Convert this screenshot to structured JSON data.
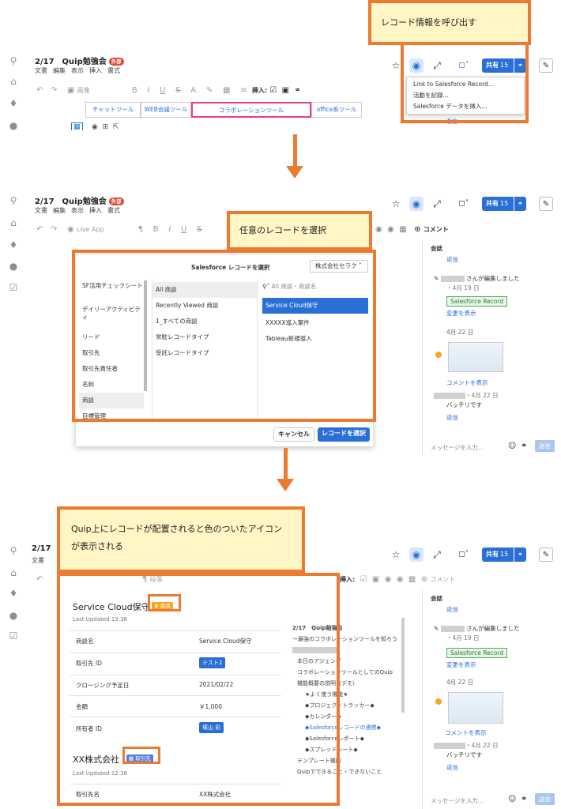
{
  "callouts": {
    "top": "レコード情報を呼び出す",
    "middle": "任意のレコードを選択",
    "bottom": "Quip上にレコードが配置されると色のついたアイコンが表示される"
  },
  "doc": {
    "title": "2/17　Quip勉強会",
    "badge": "外部",
    "menu": [
      "文書",
      "編集",
      "表示",
      "挿入",
      "書式"
    ]
  },
  "header": {
    "share_label": "共有",
    "share_count": "15"
  },
  "toolbar1": {
    "image_label": "画像",
    "insert_label": "挿入:"
  },
  "dropdown": {
    "items": [
      "Link to Salesforce Record...",
      "活動を記録...",
      "Salesforce データを挿入..."
    ]
  },
  "table1": {
    "cells": [
      "チャットツール",
      "WEB会議ツール",
      "コラボレーションツール",
      "office系ツール"
    ]
  },
  "toolbar2": {
    "live_app": "Live App",
    "comment": "コメント"
  },
  "conversation": {
    "header": "会話",
    "reply": "返信",
    "edit_text": "さんが編集しました",
    "date1": "・4月 19 日",
    "sf_record": "Salesforce Record",
    "show_changes": "変更を表示",
    "date_divider": "4月 22 日",
    "show_comment": "コメントを表示",
    "date2": "・4月 22 日",
    "comment_text": "バッチリです",
    "reply2": "返信",
    "message_placeholder": "メッセージを入力...",
    "send": "送信"
  },
  "picker": {
    "title": "Salesforce レコードを選択",
    "org": "株式会社セラク",
    "objects": [
      "SF活用チェックシート",
      "デイリーアクティビティ",
      "リード",
      "取引先",
      "取引先責任者",
      "名刺",
      "商談",
      "目標管理"
    ],
    "views": [
      "All 商談",
      "Recently Viewed 商談",
      "1_すべての商談",
      "常駐レコードタイプ",
      "受託レコードタイプ"
    ],
    "search_placeholder": "All 商談・商談名",
    "results": [
      "Service Cloud保守",
      "XXXXX導入案件",
      "Tableau新規導入"
    ],
    "cancel": "キャンセル",
    "select": "レコードを選択"
  },
  "record1": {
    "title": "Service Cloud保守",
    "badge": "商談",
    "updated": "Last Updated 12:38",
    "rows": [
      {
        "label": "商談名",
        "value": "Service Cloud保守"
      },
      {
        "label": "取引先 ID",
        "value": "テスト2"
      },
      {
        "label": "クロージング予定日",
        "value": "2021/02/22"
      },
      {
        "label": "金額",
        "value": "￥1,000"
      },
      {
        "label": "所有者 ID",
        "value": "塚山 彩"
      }
    ]
  },
  "record2": {
    "title": "XX株式会社",
    "badge": "取引先",
    "updated": "Last Updated 12:38",
    "rows": [
      {
        "label": "取引先名",
        "value": "XX株式会社"
      }
    ]
  },
  "outline": {
    "items": [
      "2/17　Quip勉強会",
      "～最強のコラボレーションツールを知ろう～",
      "本日のアジェンダ",
      "コラボレーションツールとしてのQuip",
      "機能概要の説明（デモ）",
      "★よく使う機能★",
      "◆プロジェクトトラッカー◆",
      "◆カレンダー◆",
      "◆Salesforceレコードの連携◆",
      "◆Salesforceレポート◆",
      "◆スプレッドシート◆",
      "テンプレート機能",
      "Quipでできること・できないこと"
    ]
  },
  "toolbar3": {
    "paragraph": "段落",
    "insert_label": "挿入:",
    "comment": "コメント"
  },
  "colors": {
    "accent": "#ec7a30",
    "brand_blue": "#2a6fd6"
  }
}
